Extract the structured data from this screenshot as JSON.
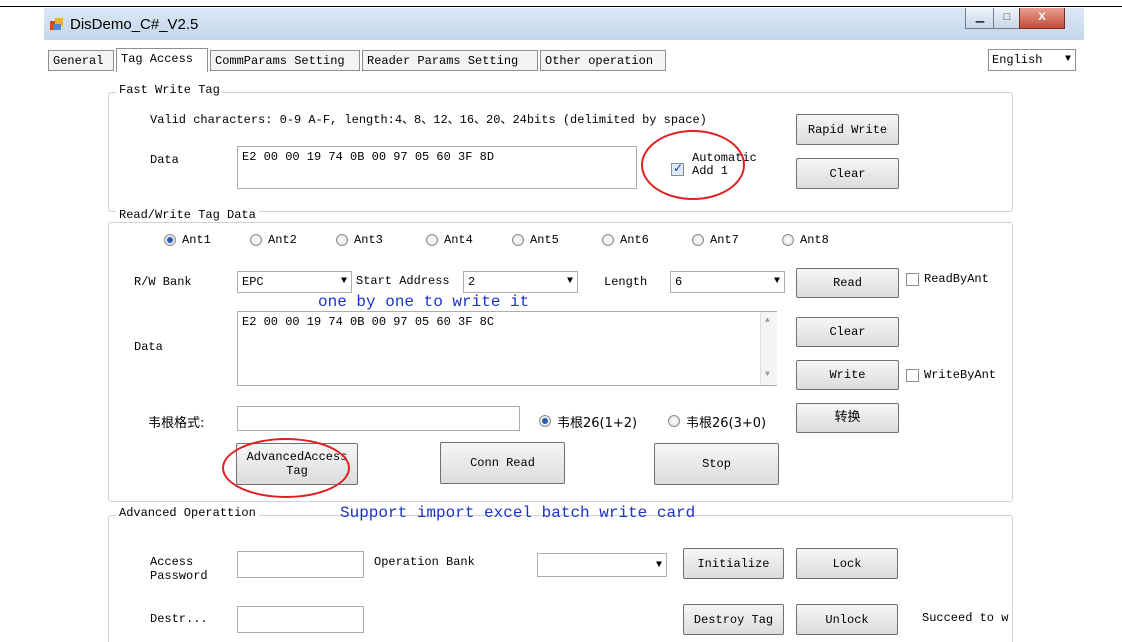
{
  "window": {
    "title": "DisDemo_C#_V2.5",
    "controls": {
      "minimize": "▁",
      "maximize": "□",
      "close": "X"
    }
  },
  "tabs": [
    "General",
    "Tag Access",
    "CommParams Setting",
    "Reader Params Setting",
    "Other operation"
  ],
  "language": "English",
  "fast_write": {
    "group_label": "Fast Write Tag",
    "hint": "Valid characters: 0-9 A-F, length:4、8、12、16、20、24bits (delimited by space)",
    "data_label": "Data",
    "data_value": "E2 00 00 19 74 0B 00 97 05 60 3F 8D",
    "auto_add_label_1": "Automatic",
    "auto_add_label_2": "Add 1",
    "rapid_write": "Rapid Write",
    "clear": "Clear"
  },
  "rw": {
    "group_label": "Read/Write Tag Data",
    "antennas": [
      "Ant1",
      "Ant2",
      "Ant3",
      "Ant4",
      "Ant5",
      "Ant6",
      "Ant7",
      "Ant8"
    ],
    "bank_label": "R/W Bank",
    "bank_value": "EPC",
    "start_label": "Start Address",
    "start_value": "2",
    "length_label": "Length",
    "length_value": "6",
    "read": "Read",
    "read_by_ant": "ReadByAnt",
    "annotation": "one by one to write it",
    "data_label": "Data",
    "data_value": "E2 00 00 19 74 0B 00 97 05 60 3F 8C",
    "clear": "Clear",
    "write": "Write",
    "write_by_ant": "WriteByAnt",
    "wiegand_label": "韦根格式:",
    "wiegand_opt1": "韦根26(1+2)",
    "wiegand_opt2": "韦根26(3+0)",
    "convert": "转换",
    "advanced_1": "AdvancedAccess",
    "advanced_2": "Tag",
    "conn_read": "Conn Read",
    "stop": "Stop"
  },
  "advanced": {
    "group_label": "Advanced Operattion",
    "annotation": "Support import excel batch write card",
    "access_pw_1": "Access",
    "access_pw_2": "Password",
    "op_bank_label": "Operation Bank",
    "initialize": "Initialize",
    "lock": "Lock",
    "destroy_label": "Destr...",
    "destroy_tag": "Destroy Tag",
    "unlock": "Unlock",
    "status": "Succeed to w"
  }
}
